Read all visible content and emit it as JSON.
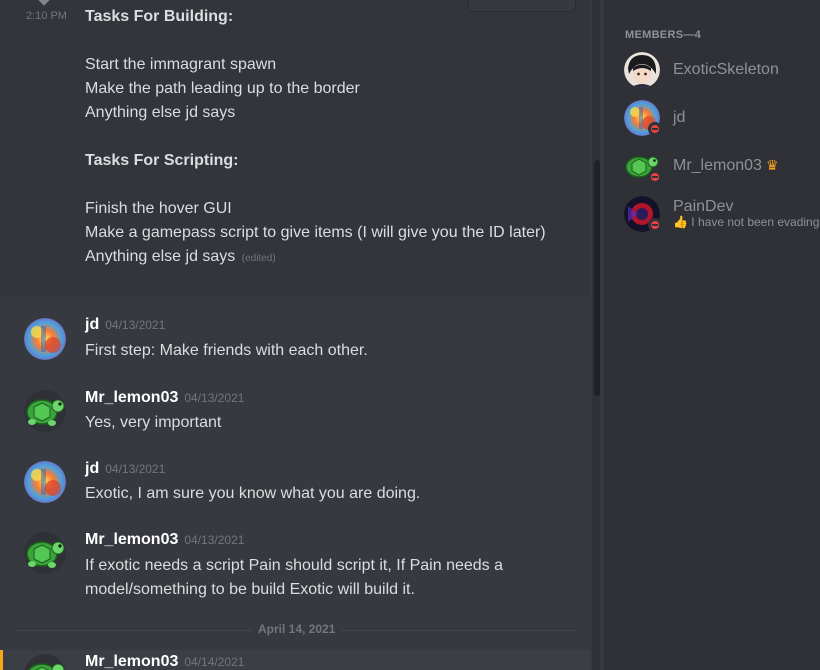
{
  "continued_message": {
    "time": "2:10 PM",
    "lines": [
      {
        "text": "Tasks For Building:",
        "style": "bold"
      },
      {
        "text": "",
        "style": "blank"
      },
      {
        "text": "Start the immagrant spawn",
        "style": "normal"
      },
      {
        "text": "Make the path leading up to the border",
        "style": "normal"
      },
      {
        "text": "Anything else jd says",
        "style": "normal"
      },
      {
        "text": "",
        "style": "blank"
      },
      {
        "text": "Tasks For Scripting:",
        "style": "bold"
      },
      {
        "text": "",
        "style": "blank"
      },
      {
        "text": "Finish the hover GUI",
        "style": "normal"
      },
      {
        "text": "Make a gamepass script to give items (I will give you the ID later)",
        "style": "wrap"
      },
      {
        "text": "Anything else jd says",
        "style": "normal"
      }
    ],
    "edited_label": "(edited)"
  },
  "messages": [
    {
      "author": "jd",
      "date": "04/13/2021",
      "avatar": "jd-avatar",
      "text": "First step: Make friends with each other."
    },
    {
      "author": "Mr_lemon03",
      "date": "04/13/2021",
      "avatar": "turtle-avatar",
      "text": "Yes, very important"
    },
    {
      "author": "jd",
      "date": "04/13/2021",
      "avatar": "jd-avatar",
      "text": "Exotic, I am sure you know what you are doing."
    },
    {
      "author": "Mr_lemon03",
      "date": "04/13/2021",
      "avatar": "turtle-avatar",
      "text": "If exotic needs a script Pain should script it, If Pain needs a model/something to be build Exotic will build it."
    },
    {
      "author": "Mr_lemon03",
      "date": "04/14/2021",
      "avatar": "turtle-avatar",
      "text": ""
    }
  ],
  "date_divider": "April 14, 2021",
  "members": {
    "header": "MEMBERS—4",
    "list": [
      {
        "name": "ExoticSkeleton",
        "avatar": "anime-avatar",
        "dnd": false,
        "owner": false,
        "status": ""
      },
      {
        "name": "jd",
        "avatar": "jd-avatar",
        "dnd": true,
        "owner": false,
        "status": ""
      },
      {
        "name": "Mr_lemon03",
        "avatar": "turtle-avatar",
        "dnd": true,
        "owner": true,
        "status": ""
      },
      {
        "name": "PainDev",
        "avatar": "paindev-avatar",
        "dnd": true,
        "owner": false,
        "status": "I have not been evading"
      }
    ]
  },
  "colors": {
    "background": "#36393f",
    "sidebar": "#2f3136",
    "owner_crown": "#faa61a",
    "dnd": "#ed4245"
  }
}
